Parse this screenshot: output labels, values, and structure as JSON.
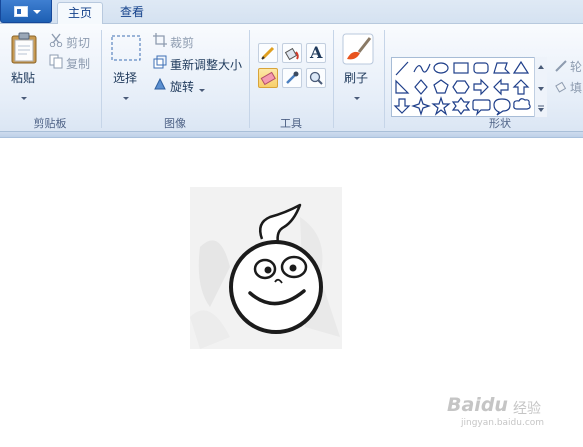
{
  "tabs": [
    {
      "label": "主页"
    },
    {
      "label": "查看"
    }
  ],
  "clipboard": {
    "paste_label": "粘贴",
    "cut_label": "剪切",
    "copy_label": "复制",
    "group_label": "剪贴板"
  },
  "image": {
    "select_label": "选择",
    "crop_label": "裁剪",
    "resize_label": "重新调整大小",
    "rotate_label": "旋转",
    "group_label": "图像"
  },
  "tools": {
    "group_label": "工具",
    "text_tool_glyph": "A",
    "items": [
      "pencil-icon",
      "fill-icon",
      "text-icon",
      "eraser-icon",
      "color-picker-icon",
      "magnifier-icon"
    ]
  },
  "brushes": {
    "label": "刷子"
  },
  "shapes": {
    "group_label": "形状",
    "outline_label": "轮",
    "fill_label": "填",
    "items": [
      "line",
      "curve",
      "oval",
      "rectangle",
      "rounded-rectangle",
      "polygon",
      "triangle",
      "right-triangle",
      "diamond",
      "pentagon",
      "hexagon",
      "right-arrow",
      "left-arrow",
      "up-arrow",
      "down-arrow",
      "four-point-star",
      "five-point-star",
      "six-point-star",
      "rounded-callout",
      "oval-callout",
      "cloud-callout"
    ]
  },
  "watermark": {
    "brand": "Baidu",
    "suffix": "经验",
    "url": "jingyan.baidu.com"
  },
  "colors": {
    "accent": "#2a66b8",
    "ribbon_text": "#1e395b",
    "selected_tool": "#f8cf6a"
  }
}
